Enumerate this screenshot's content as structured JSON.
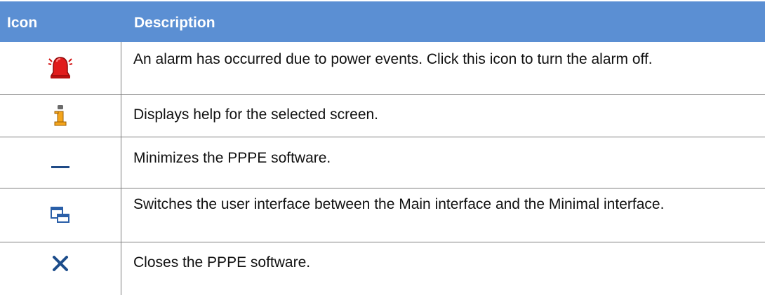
{
  "header": {
    "icon": "Icon",
    "description": "Description"
  },
  "rows": [
    {
      "icon": "alarm-bell-icon",
      "description": "An alarm has occurred due to power events. Click this icon to turn the alarm off."
    },
    {
      "icon": "info-help-icon",
      "description": "Displays help for the selected screen."
    },
    {
      "icon": "minimize-icon",
      "description": "Minimizes the PPPE software."
    },
    {
      "icon": "switch-interface-icon",
      "description": "Switches the user interface between the Main interface and the Minimal interface."
    },
    {
      "icon": "close-icon",
      "description": "Closes the PPPE software."
    }
  ],
  "colors": {
    "header_bg": "#5b8fd3",
    "header_text": "#ffffff",
    "grid_line": "#7f7f7f"
  }
}
